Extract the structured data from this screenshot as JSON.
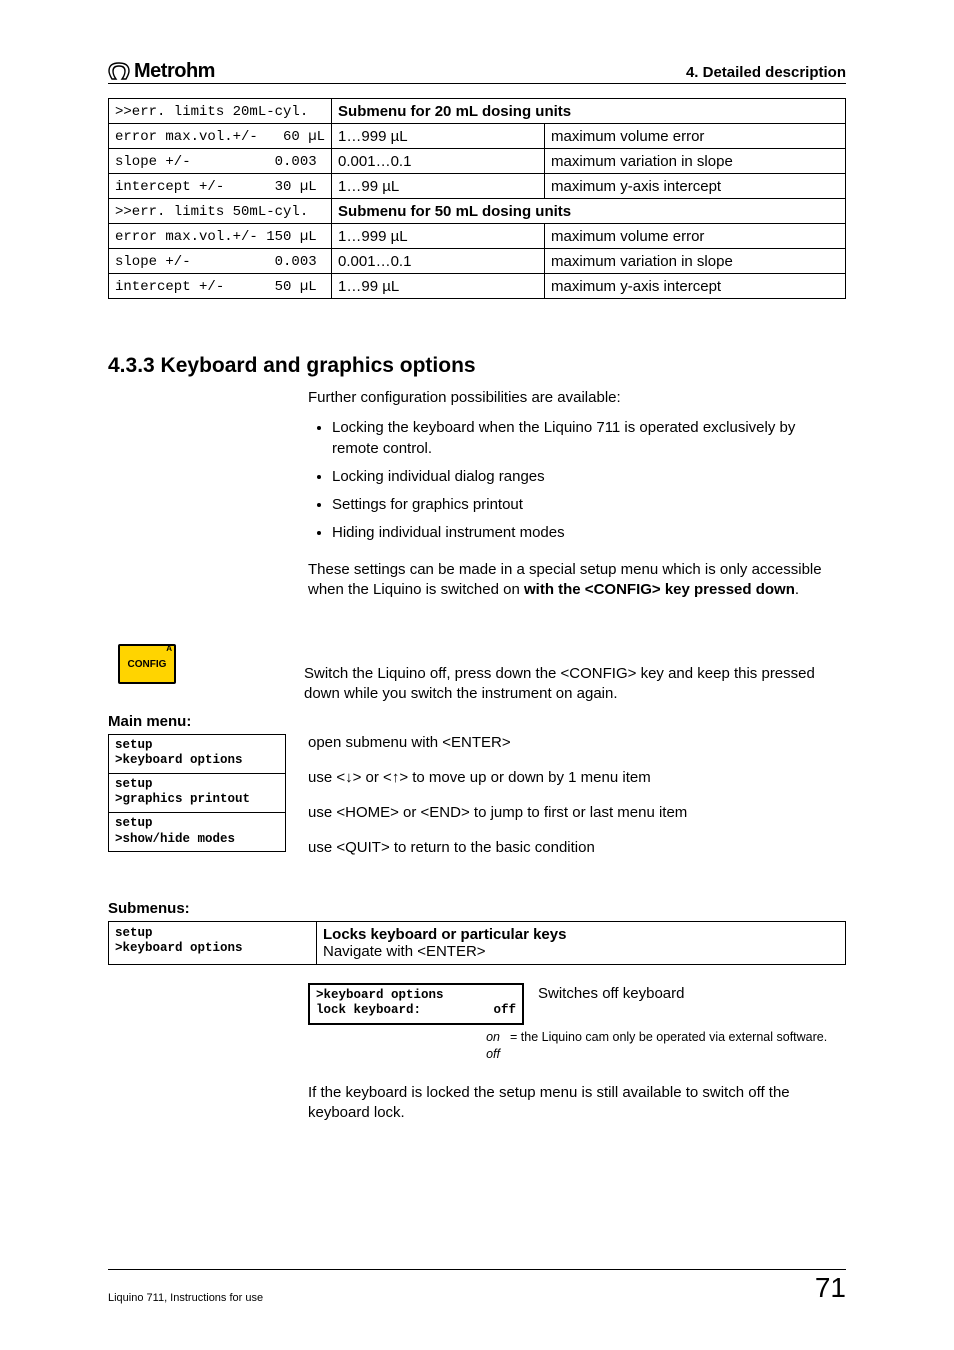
{
  "header": {
    "brand": "Metrohm",
    "right": "4. Detailed description"
  },
  "limits": {
    "rows": [
      {
        "c1": ">>err. limits 20mL-cyl.",
        "c2_merged": "Submenu for 20 mL dosing units"
      },
      {
        "c1": "error max.vol.+/-   60 µL",
        "c2": "1…999 µL",
        "c3": "maximum volume error"
      },
      {
        "c1": "slope +/-          0.003",
        "c2": "0.001…0.1",
        "c3": "maximum variation in slope"
      },
      {
        "c1": "intercept +/-      30 µL",
        "c2": "1…99 µL",
        "c3": "maximum y-axis intercept"
      },
      {
        "c1": ">>err. limits 50mL-cyl.",
        "c2_merged": "Submenu for 50 mL dosing units"
      },
      {
        "c1": "error max.vol.+/- 150 µL",
        "c2": "1…999 µL",
        "c3": "maximum volume error"
      },
      {
        "c1": "slope +/-          0.003",
        "c2": "0.001…0.1",
        "c3": "maximum variation in slope"
      },
      {
        "c1": "intercept +/-      50 µL",
        "c2": "1…99 µL",
        "c3": "maximum y-axis intercept"
      }
    ]
  },
  "section": {
    "title": "4.3.3 Keyboard and graphics options",
    "intro": "Further configuration possibilities are available:",
    "bullets": [
      "Locking the keyboard when the Liquino 711 is operated exclusively by remote control.",
      "Locking individual dialog ranges",
      "Settings for graphics printout",
      "Hiding individual instrument modes"
    ],
    "note_pre": "These settings can be made in a special setup menu which is only accessible when the Liquino is switched on ",
    "note_bold": "with the <CONFIG> key pressed down",
    "note_post": "."
  },
  "config": {
    "key_label": "CONFIG",
    "key_sup": "A",
    "text": "Switch the Liquino off, press down the <CONFIG> key and keep this pressed down while you switch the instrument on again."
  },
  "main_menu": {
    "label": "Main menu:",
    "items": [
      "setup\n>keyboard options",
      "setup\n>graphics printout",
      "setup\n>show/hide modes"
    ],
    "desc": [
      "open submenu with <ENTER>",
      "use <↓> or <↑> to move up or down by 1 menu item",
      "use <HOME> or <END> to jump to first or last menu item",
      "use <QUIT> to return to the basic condition"
    ]
  },
  "submenus": {
    "label": "Submenus:",
    "left": "setup\n>keyboard options",
    "right_bold": "Locks keyboard or particular keys",
    "right_text": "Navigate with <ENTER>"
  },
  "kb": {
    "box_left": ">keyboard options\nlock keyboard:",
    "box_right": "off",
    "right_text": "Switches off keyboard",
    "opt_on_label": "on",
    "opt_on_text": "= the Liquino cam only be operated via external software.",
    "opt_off_label": "off",
    "tail": "If the keyboard is locked the setup menu is still available to switch off the keyboard lock."
  },
  "footer": {
    "left": "Liquino 711, Instructions for use",
    "right": "71"
  }
}
